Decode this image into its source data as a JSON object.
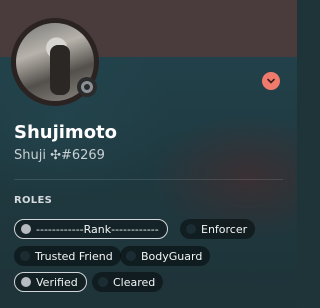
{
  "profile": {
    "username": "Shujimoto",
    "tag": "Shuji ✣#6269",
    "status": "offline"
  },
  "roles": {
    "header": "ROLES",
    "items": [
      {
        "label": "------------Rank------------",
        "style": "boxed"
      },
      {
        "label": "Enforcer",
        "style": "plain"
      },
      {
        "label": "Trusted Friend",
        "style": "plain"
      },
      {
        "label": "BodyGuard",
        "style": "plain"
      },
      {
        "label": "Verified",
        "style": "boxed"
      },
      {
        "label": "Cleared",
        "style": "plain"
      }
    ]
  },
  "colors": {
    "banner": "#4a3c3c",
    "accent_chevron": "#f07a6c",
    "background": "#1f3438"
  },
  "icons": {
    "status": "status-ring-icon",
    "expand": "chevron-down-icon"
  }
}
